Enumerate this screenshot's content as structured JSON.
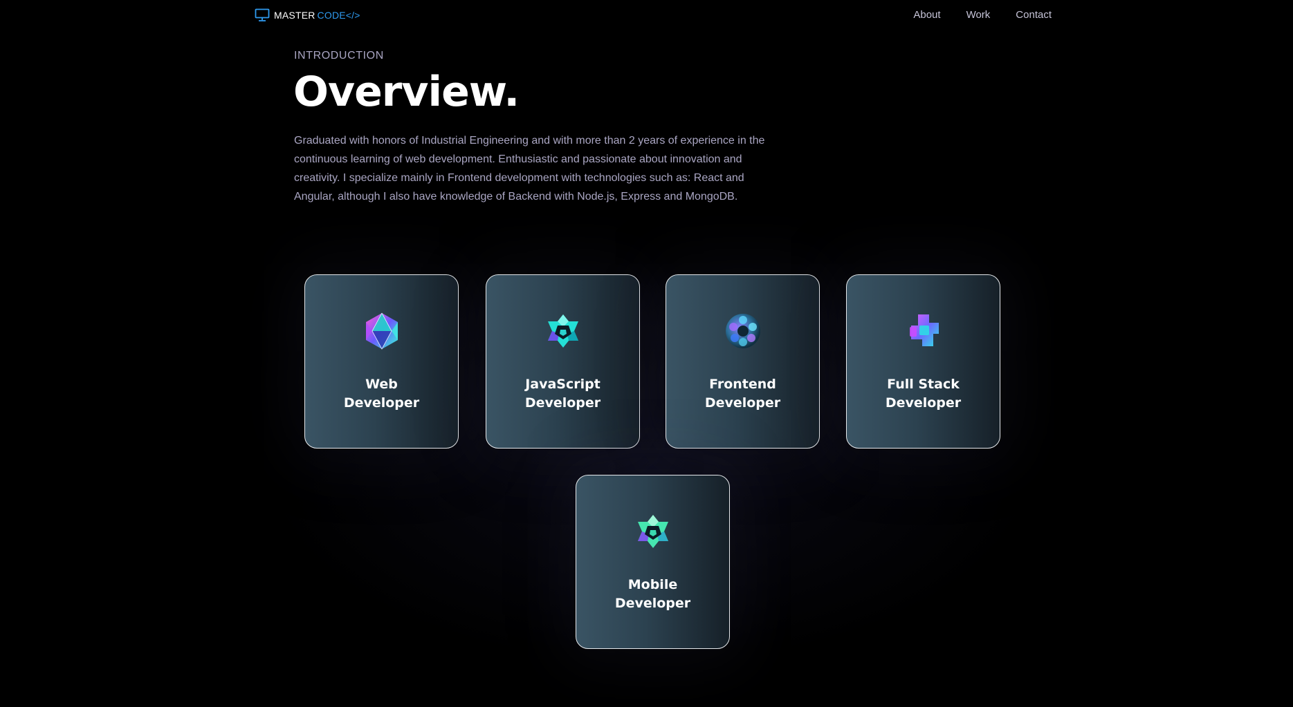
{
  "nav": {
    "logo_master": "MASTER",
    "logo_code": "CODE</>",
    "links": [
      "About",
      "Work",
      "Contact"
    ]
  },
  "intro": {
    "label": "INTRODUCTION",
    "title": "Overview.",
    "text": "Graduated with honors of Industrial Engineering and with more than 2 years of experience in the continuous learning of web development. Enthusiastic and passionate about innovation and creativity. I specialize mainly in Frontend development with technologies such as: React and Angular, although I also have knowledge of Backend with Node.js, Express and MongoDB."
  },
  "services": [
    {
      "line1": "Web",
      "line2": "Developer",
      "icon": "icosahedron-icon"
    },
    {
      "line1": "JavaScript",
      "line2": "Developer",
      "icon": "star-cube-icon"
    },
    {
      "line1": "Frontend",
      "line2": "Developer",
      "icon": "sphere-icon"
    },
    {
      "line1": "Full Stack",
      "line2": "Developer",
      "icon": "cross-blob-icon"
    },
    {
      "line1": "Mobile",
      "line2": "Developer",
      "icon": "star-cube-icon"
    }
  ],
  "colors": {
    "background": "#000000",
    "accent": "#2f9bf0",
    "secondary_text": "#aaa6c3",
    "card_gradient_start": "#3a5464",
    "card_gradient_end": "#162028"
  }
}
